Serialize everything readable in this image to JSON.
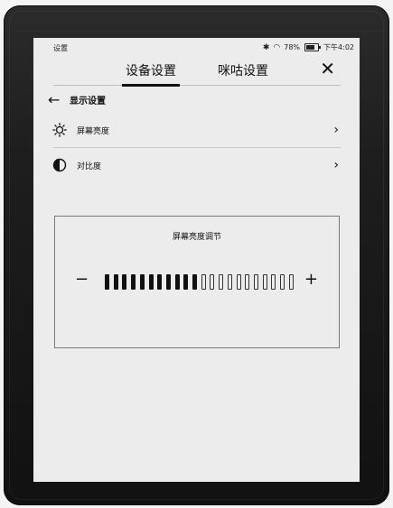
{
  "status_bar": {
    "left_label": "设置",
    "bluetooth_icon": "bluetooth-icon",
    "wifi_icon": "wifi-icon",
    "battery_percent": "78%",
    "time": "下午4:02"
  },
  "tabs": [
    {
      "label": "设备设置",
      "active": true
    },
    {
      "label": "咪咕设置",
      "active": false
    }
  ],
  "close_icon": "close-icon",
  "back": {
    "title": "显示设置"
  },
  "settings": [
    {
      "label": "屏幕亮度",
      "icon": "sun-icon"
    },
    {
      "label": "对比度",
      "icon": "contrast-icon"
    }
  ],
  "brightness_panel": {
    "title": "屏幕亮度调节",
    "minus_label": "−",
    "plus_label": "+",
    "level": 11,
    "total_steps": 22
  }
}
